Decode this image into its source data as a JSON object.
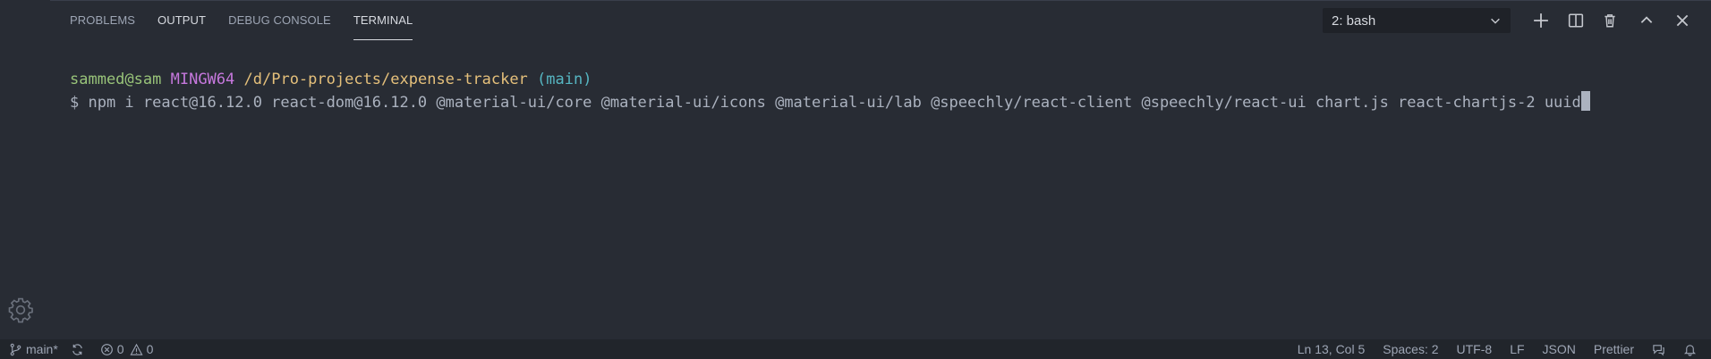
{
  "panel": {
    "tabs": [
      {
        "label": "PROBLEMS"
      },
      {
        "label": "OUTPUT"
      },
      {
        "label": "DEBUG CONSOLE"
      },
      {
        "label": "TERMINAL"
      }
    ],
    "terminal_select": "2: bash",
    "icons": [
      "plus-icon",
      "split-icon",
      "trash-icon",
      "chevron-up-icon",
      "close-icon"
    ]
  },
  "terminal": {
    "user_host": "sammed@sam",
    "system": "MINGW64",
    "path": "/d/Pro-projects/expense-tracker",
    "branch": "(main)",
    "command": "$ npm i react@16.12.0 react-dom@16.12.0 @material-ui/core @material-ui/icons @material-ui/lab @speechly/react-client @speechly/react-ui chart.js react-chartjs-2 uuid"
  },
  "status": {
    "branch": "main*",
    "errors": "0",
    "warnings": "0",
    "position": "Ln 13, Col 5",
    "spaces": "Spaces: 2",
    "encoding": "UTF-8",
    "eol": "LF",
    "language": "JSON",
    "formatter": "Prettier"
  },
  "colors": {
    "background": "#282c34",
    "user": "#98c379",
    "host": "#c678dd",
    "path": "#e5c07b",
    "branch": "#56b6c2"
  }
}
